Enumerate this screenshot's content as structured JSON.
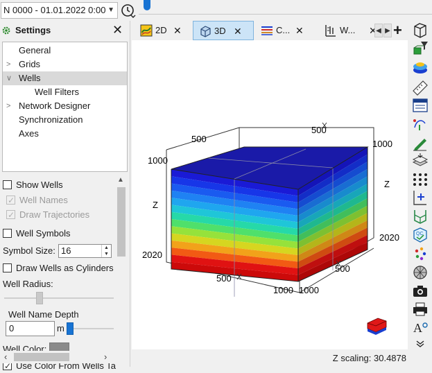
{
  "topbar": {
    "time_selector": "N 0000 - 01.01.2022 0:00",
    "clock_icon": "clock-history-icon"
  },
  "settings": {
    "title": "Settings",
    "tree": [
      {
        "label": "General",
        "expandable": false,
        "level": 0
      },
      {
        "label": "Grids",
        "expandable": true,
        "expanded": false,
        "level": 0
      },
      {
        "label": "Wells",
        "expandable": true,
        "expanded": true,
        "level": 0,
        "selected": true
      },
      {
        "label": "Well Filters",
        "expandable": false,
        "level": 1
      },
      {
        "label": "Network Designer",
        "expandable": true,
        "expanded": false,
        "level": 0
      },
      {
        "label": "Synchronization",
        "expandable": false,
        "level": 0
      },
      {
        "label": "Axes",
        "expandable": false,
        "level": 0
      }
    ],
    "props": {
      "show_wells": {
        "label": "Show Wells",
        "checked": false
      },
      "well_names": {
        "label": "Well Names",
        "checked": true,
        "disabled": true
      },
      "draw_trajectories": {
        "label": "Draw Trajectories",
        "checked": true,
        "disabled": true
      },
      "well_symbols": {
        "label": "Well Symbols",
        "checked": false
      },
      "symbol_size_label": "Symbol Size:",
      "symbol_size": "16",
      "draw_cylinders": {
        "label": "Draw Wells as Cylinders",
        "checked": false
      },
      "well_radius_label": "Well Radius:",
      "well_name_depth_label": "Well Name Depth",
      "well_name_depth": "0",
      "well_name_depth_unit": "m",
      "well_color_label": "Well Color:",
      "well_color": "#8a8a8a",
      "use_color": {
        "label": "Use Color From Wells Ta",
        "checked": true
      }
    }
  },
  "tabs": [
    {
      "label": "2D",
      "icon": "map-2d-icon",
      "active": false
    },
    {
      "label": "3D",
      "icon": "cube-3d-icon",
      "active": true
    },
    {
      "label": "C...",
      "icon": "correlation-icon",
      "active": false
    },
    {
      "label": "W...",
      "icon": "well-section-icon",
      "active": false
    }
  ],
  "viewport": {
    "axis_labels": {
      "top_left_500": "500",
      "top_right_500": "500",
      "top_right_1000": "1000",
      "left_1000": "1000",
      "left_z": "Z",
      "left_2020": "2020",
      "right_z": "Z",
      "right_2020": "2020",
      "bottom_500_left": "500",
      "bottom_1000_mid": "1000",
      "bottom_1000_right": "1000",
      "bottom_500_right": "500"
    },
    "layer_colors_front": [
      "#1a1ad6",
      "#1736e8",
      "#1a5bf0",
      "#1f82f3",
      "#1fa6ef",
      "#1fc6d8",
      "#26d9a8",
      "#4fe06b",
      "#96e23b",
      "#d6d620",
      "#f2a21a",
      "#f25a14",
      "#e01212",
      "#cc0a0a"
    ],
    "layer_colors_side": [
      "#1414b8",
      "#132dc7",
      "#154cd0",
      "#196dd2",
      "#188bcd",
      "#18a6b9",
      "#1fb88f",
      "#41be5b",
      "#7ec031",
      "#b5b51a",
      "#cf8816",
      "#cf4b11",
      "#bf0f0f",
      "#ad0808"
    ],
    "top_color": "#1a1aa8"
  },
  "status": {
    "z_scaling": "Z scaling: 30.4878"
  },
  "right_toolbar": [
    "perspective-box-icon",
    "filter-icon",
    "layers-icon",
    "surfaces-icon",
    "ruler-icon",
    "table-icon",
    "well-path-icon",
    "fault-pen-icon",
    "grid-stack-icon",
    "points-icon",
    "add-pipe-icon",
    "trajectory-icon",
    "qc-icon",
    "scatter-icon",
    "sphere-mesh-icon",
    "camera-icon",
    "print-icon",
    "text-format-icon",
    "more-chevron-icon"
  ]
}
